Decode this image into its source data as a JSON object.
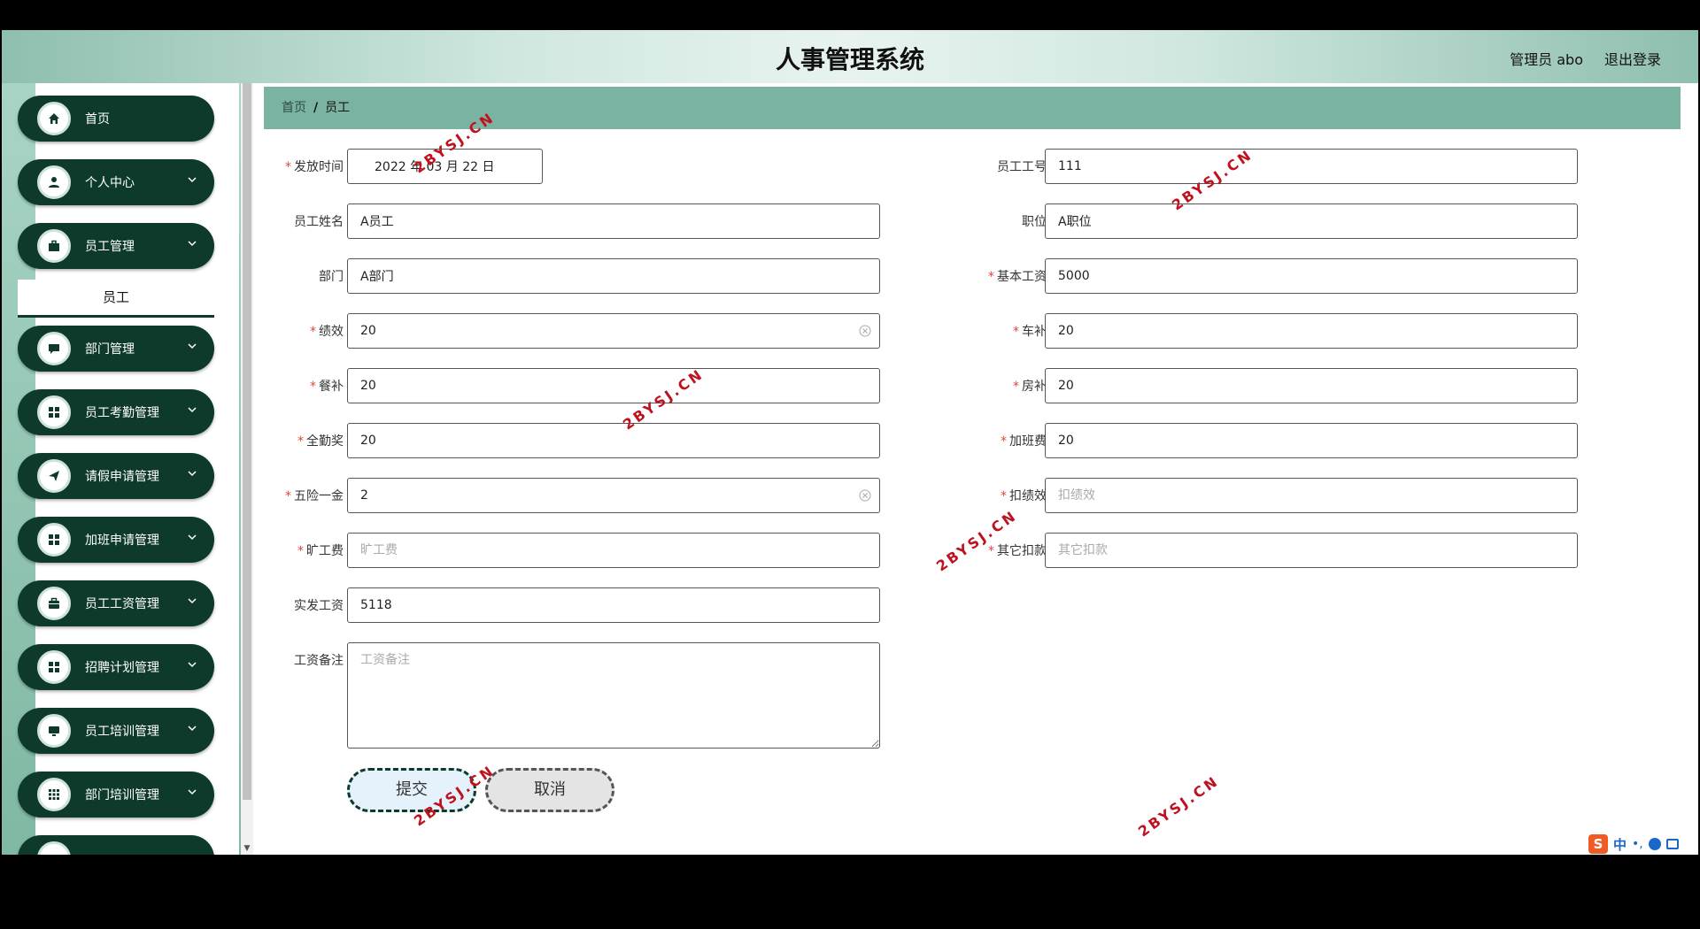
{
  "header": {
    "title": "人事管理系统",
    "user": "管理员 abo",
    "logout": "退出登录"
  },
  "sidebar": {
    "items": [
      {
        "label": "首页",
        "icon": "home-icon"
      },
      {
        "label": "个人中心",
        "icon": "user-icon"
      },
      {
        "label": "员工管理",
        "icon": "briefcase-icon"
      },
      {
        "label": "部门管理",
        "icon": "chat-icon"
      },
      {
        "label": "员工考勤管理",
        "icon": "grid-icon"
      },
      {
        "label": "请假申请管理",
        "icon": "paper-plane-icon"
      },
      {
        "label": "加班申请管理",
        "icon": "grid-icon"
      },
      {
        "label": "员工工资管理",
        "icon": "toolbox-icon"
      },
      {
        "label": "招聘计划管理",
        "icon": "grid-icon"
      },
      {
        "label": "员工培训管理",
        "icon": "monitor-icon"
      },
      {
        "label": "部门培训管理",
        "icon": "apps-icon"
      }
    ],
    "subitem": "员工"
  },
  "breadcrumb": {
    "home": "首页",
    "separator": "/",
    "current": "员工"
  },
  "form": {
    "issue_time": {
      "label": "发放时间",
      "value": "2022 年 03 月 22 日"
    },
    "emp_no": {
      "label": "员工工号",
      "value": "111"
    },
    "emp_name": {
      "label": "员工姓名",
      "value": "A员工"
    },
    "position": {
      "label": "职位",
      "value": "A职位"
    },
    "department": {
      "label": "部门",
      "value": "A部门"
    },
    "base_salary": {
      "label": "基本工资",
      "value": "5000"
    },
    "performance": {
      "label": "绩效",
      "value": "20"
    },
    "car_allowance": {
      "label": "车补",
      "value": "20"
    },
    "meal_allowance": {
      "label": "餐补",
      "value": "20"
    },
    "housing_allowance": {
      "label": "房补",
      "value": "20"
    },
    "attendance_bonus": {
      "label": "全勤奖",
      "value": "20"
    },
    "overtime_pay": {
      "label": "加班费",
      "value": "20"
    },
    "insurance": {
      "label": "五险一金",
      "value": "2"
    },
    "perf_deduction": {
      "label": "扣绩效",
      "placeholder": "扣绩效"
    },
    "absence_fee": {
      "label": "旷工费",
      "placeholder": "旷工费"
    },
    "other_deduction": {
      "label": "其它扣款",
      "placeholder": "其它扣款"
    },
    "net_salary": {
      "label": "实发工资",
      "value": "5118"
    },
    "remark": {
      "label": "工资备注",
      "placeholder": "工资备注"
    }
  },
  "buttons": {
    "submit": "提交",
    "cancel": "取消"
  },
  "watermark": "2BYSJ.CN",
  "ime": {
    "logo": "S",
    "lang": "中"
  },
  "colors": {
    "menu_bg": "#0e3a2c",
    "breadcrumb_bg": "#7ab3a1",
    "required": "#e0463a",
    "watermark": "#c0111f"
  }
}
